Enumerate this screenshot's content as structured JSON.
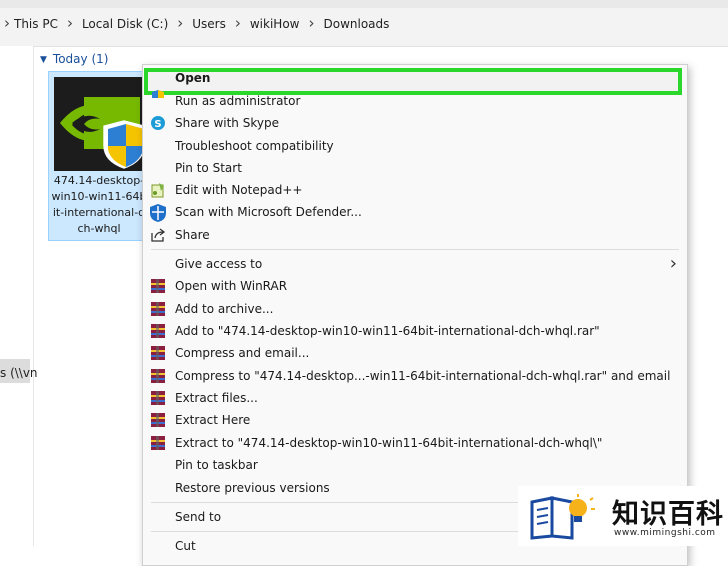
{
  "breadcrumb": {
    "items": [
      "This PC",
      "Local Disk (C:)",
      "Users",
      "wikiHow",
      "Downloads"
    ]
  },
  "nav": {
    "truncated_item": "s (\\\\vn"
  },
  "content": {
    "group_header": "Today (1)",
    "file": {
      "name_lines": [
        "474.14-desktop-",
        "win10-win11-64b",
        "it-international-d",
        "ch-whql"
      ]
    }
  },
  "context_menu": {
    "items": [
      {
        "label": "Open",
        "icon": "none",
        "bold": true
      },
      {
        "label": "Run as administrator",
        "icon": "uac-shield-icon"
      },
      {
        "label": "Share with Skype",
        "icon": "skype-icon"
      },
      {
        "label": "Troubleshoot compatibility",
        "icon": "none"
      },
      {
        "label": "Pin to Start",
        "icon": "none"
      },
      {
        "label": "Edit with Notepad++",
        "icon": "notepad-plus-plus-icon"
      },
      {
        "label": "Scan with Microsoft Defender...",
        "icon": "defender-shield-icon"
      },
      {
        "label": "Share",
        "icon": "share-icon"
      },
      {
        "label": "Give access to",
        "icon": "none",
        "submenu": true
      },
      {
        "label": "Open with WinRAR",
        "icon": "winrar-icon"
      },
      {
        "label": "Add to archive...",
        "icon": "winrar-icon"
      },
      {
        "label": "Add to \"474.14-desktop-win10-win11-64bit-international-dch-whql.rar\"",
        "icon": "winrar-icon"
      },
      {
        "label": "Compress and email...",
        "icon": "winrar-icon"
      },
      {
        "label": "Compress to \"474.14-desktop...-win11-64bit-international-dch-whql.rar\" and email",
        "icon": "winrar-icon"
      },
      {
        "label": "Extract files...",
        "icon": "winrar-icon"
      },
      {
        "label": "Extract Here",
        "icon": "winrar-icon"
      },
      {
        "label": "Extract to \"474.14-desktop-win10-win11-64bit-international-dch-whql\\\"",
        "icon": "winrar-icon"
      },
      {
        "label": "Pin to taskbar",
        "icon": "none"
      },
      {
        "label": "Restore previous versions",
        "icon": "none"
      },
      {
        "label": "Send to",
        "icon": "none",
        "submenu": true
      },
      {
        "label": "Cut",
        "icon": "none"
      }
    ]
  },
  "watermark": {
    "title": "知识百科",
    "url": "www.mimingshi.com"
  },
  "colors": {
    "highlight_border": "#2cd72c",
    "selection_fill": "#cce8ff",
    "nvidia_green": "#76b900"
  }
}
